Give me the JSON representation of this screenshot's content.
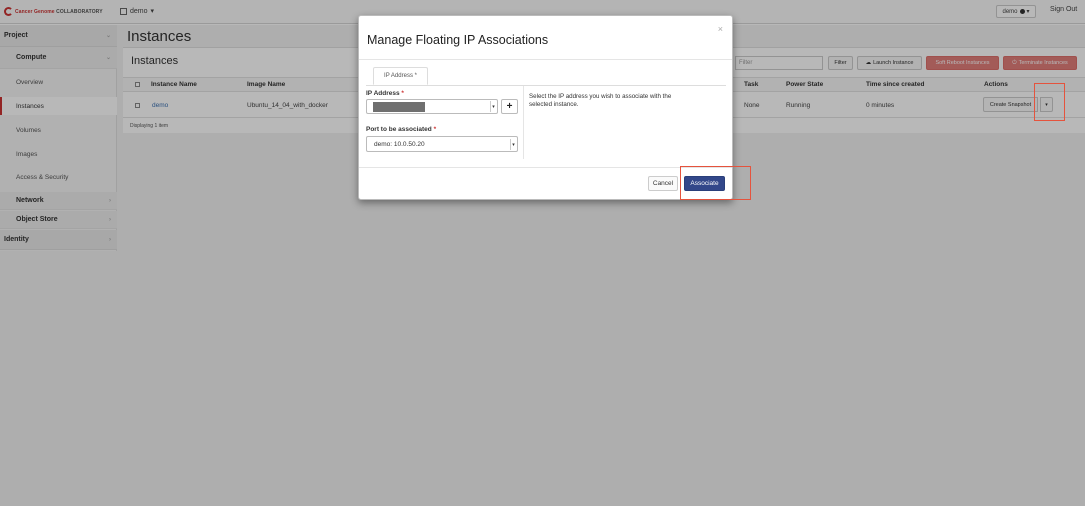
{
  "topbar": {
    "brand_prefix": "Cancer Genome",
    "brand_suffix": "COLLABORATORY",
    "project_name": "demo",
    "project_caret": "▾",
    "user_name": "demo",
    "user_caret": "▾",
    "signout": "Sign Out"
  },
  "sidebar": {
    "project": "Project",
    "compute": "Compute",
    "items": [
      "Overview",
      "Instances",
      "Volumes",
      "Images",
      "Access & Security"
    ],
    "network": "Network",
    "object_store": "Object Store",
    "identity": "Identity",
    "collapse_chevron": "⌄",
    "expand_chevron": "›"
  },
  "main": {
    "page_title": "Instances",
    "panel_title": "Instances",
    "filter_placeholder": "Filter",
    "filter_button": "Filter",
    "launch_button": "Launch Instance",
    "soft_reboot_button": "Soft Reboot Instances",
    "terminate_button": "Terminate Instances",
    "columns": [
      "Instance Name",
      "Image Name",
      "Task",
      "Power State",
      "Time since created",
      "Actions"
    ],
    "rows": [
      {
        "instance_name": "demo",
        "image_name": "Ubuntu_14_04_with_docker",
        "task": "None",
        "power_state": "Running",
        "time_since_created": "0 minutes",
        "action": "Create Snapshot",
        "action_caret": "▾"
      }
    ],
    "footer": "Displaying 1 item"
  },
  "modal": {
    "title": "Manage Floating IP Associations",
    "close": "×",
    "tab": "IP Address *",
    "ip_label": "IP Address",
    "required_mark": "*",
    "ip_caret": "▾",
    "add_button": "+",
    "port_label": "Port to be associated",
    "port_value": "demo: 10.0.50.20",
    "port_caret": "▾",
    "help_text": "Select the IP address you wish to associate with the selected instance.",
    "cancel_button": "Cancel",
    "associate_button": "Associate"
  },
  "colors": {
    "accent_red": "#cc3333",
    "primary_button": "#32478a",
    "danger_button": "#d9534f",
    "highlight_box": "#e5533d"
  }
}
